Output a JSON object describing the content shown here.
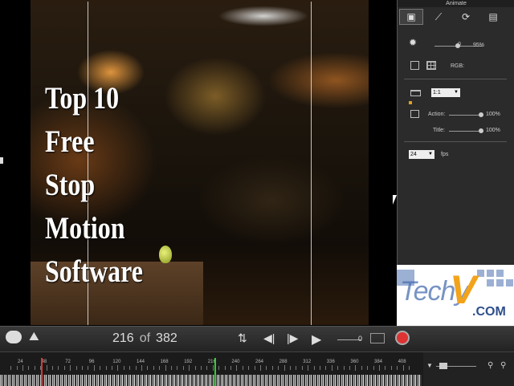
{
  "overlay_title": [
    "Top 10",
    "Free",
    "Stop",
    "Motion",
    "Software"
  ],
  "panel": {
    "title": "Animate",
    "tabs": [
      {
        "name": "camera-tab",
        "icon": "camera-icon",
        "glyph": "▣"
      },
      {
        "name": "magic-wand-tab",
        "icon": "magic-wand-icon",
        "glyph": "⟋"
      },
      {
        "name": "loop-tab",
        "icon": "loop-icon",
        "glyph": "⟳"
      },
      {
        "name": "clipboard-tab",
        "icon": "clipboard-icon",
        "glyph": "▤"
      }
    ],
    "brightness": {
      "value": "0",
      "percent": "95%",
      "level": 0.95
    },
    "rgb_label": "RGB:",
    "aspect_ratio": "1:1",
    "action": {
      "label": "Action:",
      "percent": "100%",
      "level": 1.0
    },
    "title_opacity": {
      "label": "Title:",
      "percent": "100%",
      "level": 1.0
    },
    "fps": {
      "value": "24",
      "unit": "fps"
    }
  },
  "logo": {
    "text": "Techy",
    "v": "V",
    "com": ".COM"
  },
  "toolbar": {
    "current_frame": "216",
    "of_label": "of",
    "total_frames": "382",
    "onion_value": "0"
  },
  "timeline": {
    "ticks": [
      "24",
      "48",
      "72",
      "96",
      "120",
      "144",
      "168",
      "192",
      "216",
      "240",
      "264",
      "288",
      "312",
      "336",
      "360",
      "384",
      "408"
    ]
  },
  "colors": {
    "accent_record": "#d33",
    "logo_blue": "#4a6fb0",
    "logo_orange": "#f2a31b"
  }
}
